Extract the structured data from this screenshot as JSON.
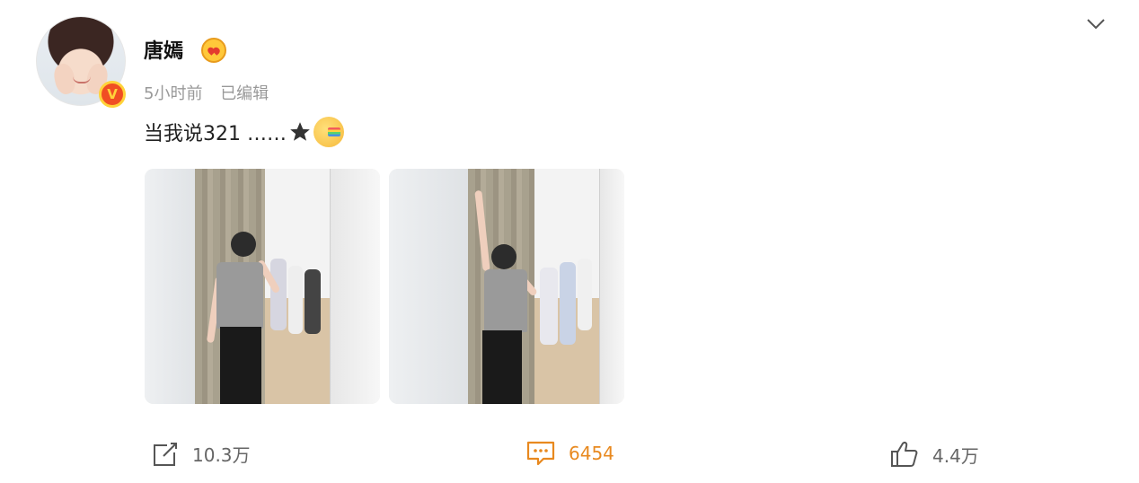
{
  "author": {
    "name": "唐嫣",
    "verified_mark": "V",
    "badge_icon": "heart-eyes-badge-icon"
  },
  "post": {
    "time": "5小时前",
    "edited": "已编辑",
    "text": "当我说321 ……",
    "emojis": [
      "star-icon",
      "rainbow-face-icon"
    ],
    "images": [
      "dance-photo-1",
      "dance-photo-2"
    ]
  },
  "actions": {
    "share_count": "10.3万",
    "comment_count": "6454",
    "like_count": "4.4万"
  },
  "colors": {
    "accent": "#e8891f",
    "muted": "#999999",
    "verified_red": "#f04e23",
    "verified_gold": "#ffd33a"
  }
}
